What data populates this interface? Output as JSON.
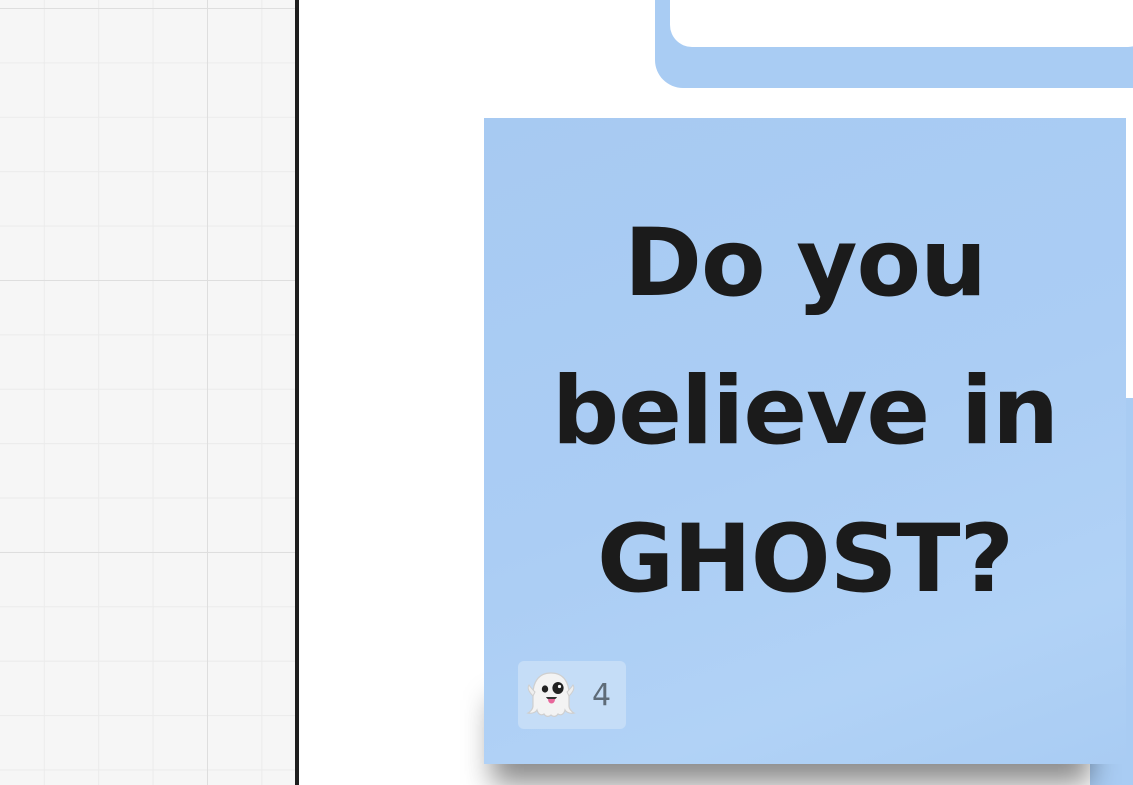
{
  "sticky_note": {
    "lines": [
      "Do you",
      "believe in",
      "GHOST?"
    ],
    "color": "#a9ccf3",
    "reaction": {
      "emoji_icon": "ghost-icon",
      "count": "4"
    }
  },
  "colors": {
    "frame_blue": "#a9ccf3",
    "grid_bg": "#f6f6f6",
    "frame_border": "#1e1e1e"
  }
}
